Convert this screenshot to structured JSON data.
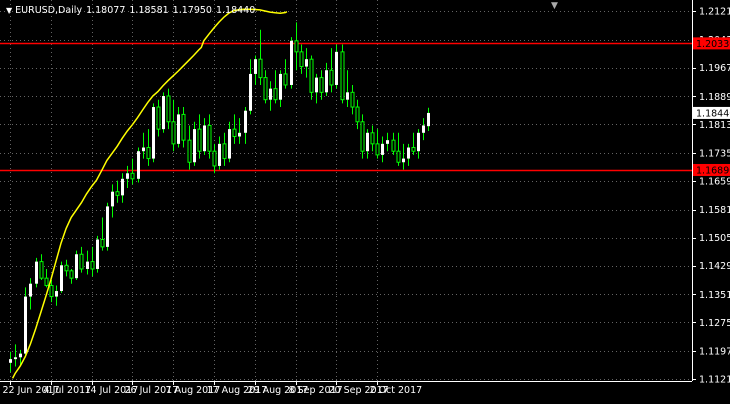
{
  "header": {
    "symbol_label": "EURUSD,Daily",
    "ohlc": [
      "1.18077",
      "1.18581",
      "1.17950",
      "1.18440"
    ]
  },
  "icons": {
    "menu": "triangle-down-icon",
    "corner": "triangle-down-icon"
  },
  "colors": {
    "background": "#000000",
    "bull": "#ffffff",
    "bear": "#000000",
    "wick": "#00ff00",
    "ma": "#ffff00",
    "hline": "#ff0000",
    "axis": "#ffffff",
    "grid": "#646464"
  },
  "chart_data": {
    "type": "candlestick",
    "title": "EURUSD,Daily",
    "grid": true,
    "ylim": [
      1.1121,
      1.2121
    ],
    "yticks": [
      "1.21210",
      "1.20430",
      "1.19670",
      "1.18890",
      "1.18130",
      "1.17350",
      "1.16590",
      "1.15810",
      "1.15050",
      "1.14290",
      "1.13510",
      "1.12750",
      "1.11970",
      "1.11210"
    ],
    "x_labels": [
      {
        "label": "22 Jun 2017",
        "index": 0
      },
      {
        "label": "4 Jul 2017",
        "index": 8
      },
      {
        "label": "14 Jul 2017",
        "index": 16
      },
      {
        "label": "26 Jul 2017",
        "index": 24
      },
      {
        "label": "7 Aug 2017",
        "index": 32
      },
      {
        "label": "17 Aug 2017",
        "index": 40
      },
      {
        "label": "29 Aug 2017",
        "index": 48
      },
      {
        "label": "8 Sep 2017",
        "index": 56
      },
      {
        "label": "20 Sep 2017",
        "index": 64
      },
      {
        "label": "2 Oct 2017",
        "index": 72
      }
    ],
    "candles": [
      [
        1.1165,
        1.1195,
        1.114,
        1.1175
      ],
      [
        1.1175,
        1.1215,
        1.1155,
        1.118
      ],
      [
        1.118,
        1.12,
        1.116,
        1.119
      ],
      [
        1.119,
        1.137,
        1.118,
        1.1345
      ],
      [
        1.1345,
        1.1395,
        1.131,
        1.138
      ],
      [
        1.138,
        1.145,
        1.137,
        1.144
      ],
      [
        1.144,
        1.146,
        1.139,
        1.1395
      ],
      [
        1.1395,
        1.142,
        1.137,
        1.1375
      ],
      [
        1.1375,
        1.139,
        1.133,
        1.1345
      ],
      [
        1.1345,
        1.1375,
        1.132,
        1.136
      ],
      [
        1.136,
        1.144,
        1.1355,
        1.143
      ],
      [
        1.143,
        1.1445,
        1.14,
        1.1415
      ],
      [
        1.1415,
        1.142,
        1.138,
        1.1395
      ],
      [
        1.1395,
        1.147,
        1.139,
        1.146
      ],
      [
        1.146,
        1.148,
        1.141,
        1.142
      ],
      [
        1.142,
        1.147,
        1.1405,
        1.144
      ],
      [
        1.144,
        1.148,
        1.14,
        1.142
      ],
      [
        1.142,
        1.151,
        1.141,
        1.15
      ],
      [
        1.15,
        1.156,
        1.147,
        1.148
      ],
      [
        1.148,
        1.16,
        1.147,
        1.159
      ],
      [
        1.159,
        1.165,
        1.156,
        1.163
      ],
      [
        1.163,
        1.166,
        1.16,
        1.162
      ],
      [
        1.162,
        1.168,
        1.16,
        1.1665
      ],
      [
        1.1665,
        1.17,
        1.164,
        1.168
      ],
      [
        1.168,
        1.172,
        1.165,
        1.1665
      ],
      [
        1.1665,
        1.175,
        1.1655,
        1.174
      ],
      [
        1.174,
        1.179,
        1.172,
        1.175
      ],
      [
        1.175,
        1.18,
        1.17,
        1.172
      ],
      [
        1.172,
        1.187,
        1.171,
        1.186
      ],
      [
        1.186,
        1.188,
        1.178,
        1.18
      ],
      [
        1.18,
        1.19,
        1.179,
        1.189
      ],
      [
        1.189,
        1.191,
        1.18,
        1.182
      ],
      [
        1.182,
        1.188,
        1.174,
        1.176
      ],
      [
        1.176,
        1.186,
        1.175,
        1.184
      ],
      [
        1.184,
        1.186,
        1.175,
        1.177
      ],
      [
        1.177,
        1.181,
        1.169,
        1.171
      ],
      [
        1.171,
        1.182,
        1.17,
        1.18
      ],
      [
        1.18,
        1.184,
        1.172,
        1.174
      ],
      [
        1.174,
        1.183,
        1.173,
        1.181
      ],
      [
        1.181,
        1.184,
        1.172,
        1.174
      ],
      [
        1.174,
        1.176,
        1.168,
        1.17
      ],
      [
        1.17,
        1.178,
        1.169,
        1.176
      ],
      [
        1.176,
        1.179,
        1.17,
        1.172
      ],
      [
        1.172,
        1.182,
        1.171,
        1.18
      ],
      [
        1.18,
        1.184,
        1.176,
        1.178
      ],
      [
        1.178,
        1.183,
        1.176,
        1.179
      ],
      [
        1.179,
        1.186,
        1.176,
        1.185
      ],
      [
        1.185,
        1.199,
        1.184,
        1.195
      ],
      [
        1.195,
        1.2,
        1.192,
        1.199
      ],
      [
        1.199,
        1.207,
        1.192,
        1.194
      ],
      [
        1.194,
        1.196,
        1.187,
        1.188
      ],
      [
        1.188,
        1.193,
        1.185,
        1.191
      ],
      [
        1.191,
        1.196,
        1.187,
        1.188
      ],
      [
        1.188,
        1.196,
        1.186,
        1.195
      ],
      [
        1.195,
        1.199,
        1.191,
        1.192
      ],
      [
        1.192,
        1.205,
        1.191,
        1.204
      ],
      [
        1.204,
        1.209,
        1.196,
        1.201
      ],
      [
        1.201,
        1.203,
        1.195,
        1.197
      ],
      [
        1.197,
        1.202,
        1.194,
        1.199
      ],
      [
        1.199,
        1.2,
        1.188,
        1.19
      ],
      [
        1.19,
        1.195,
        1.187,
        1.194
      ],
      [
        1.194,
        1.196,
        1.188,
        1.19
      ],
      [
        1.19,
        1.198,
        1.189,
        1.196
      ],
      [
        1.196,
        1.202,
        1.19,
        1.192
      ],
      [
        1.192,
        1.203,
        1.191,
        1.201
      ],
      [
        1.201,
        1.203,
        1.187,
        1.188
      ],
      [
        1.188,
        1.196,
        1.186,
        1.19
      ],
      [
        1.19,
        1.192,
        1.184,
        1.186
      ],
      [
        1.186,
        1.188,
        1.18,
        1.182
      ],
      [
        1.182,
        1.184,
        1.172,
        1.174
      ],
      [
        1.174,
        1.18,
        1.172,
        1.179
      ],
      [
        1.179,
        1.181,
        1.174,
        1.176
      ],
      [
        1.176,
        1.18,
        1.172,
        1.173
      ],
      [
        1.173,
        1.178,
        1.171,
        1.176
      ],
      [
        1.176,
        1.179,
        1.174,
        1.177
      ],
      [
        1.177,
        1.179,
        1.173,
        1.174
      ],
      [
        1.174,
        1.179,
        1.17,
        1.171
      ],
      [
        1.171,
        1.176,
        1.169,
        1.172
      ],
      [
        1.172,
        1.176,
        1.17,
        1.175
      ],
      [
        1.175,
        1.179,
        1.173,
        1.174
      ],
      [
        1.174,
        1.18,
        1.172,
        1.179
      ],
      [
        1.179,
        1.183,
        1.177,
        1.181
      ],
      [
        1.1808,
        1.1858,
        1.1795,
        1.1844
      ]
    ],
    "moving_average": [
      [
        5,
        1.1123
      ],
      [
        10,
        1.1136
      ],
      [
        20,
        1.1156
      ],
      [
        30,
        1.1182
      ],
      [
        40,
        1.1216
      ],
      [
        50,
        1.1256
      ],
      [
        60,
        1.13
      ],
      [
        70,
        1.1344
      ],
      [
        80,
        1.139
      ],
      [
        90,
        1.144
      ],
      [
        100,
        1.149
      ],
      [
        110,
        1.153
      ],
      [
        120,
        1.156
      ],
      [
        130,
        1.158
      ],
      [
        140,
        1.16
      ],
      [
        150,
        1.1624
      ],
      [
        160,
        1.1644
      ],
      [
        170,
        1.1662
      ],
      [
        180,
        1.1688
      ],
      [
        190,
        1.1715
      ],
      [
        200,
        1.1734
      ],
      [
        210,
        1.1753
      ],
      [
        220,
        1.1775
      ],
      [
        230,
        1.1795
      ],
      [
        240,
        1.1812
      ],
      [
        250,
        1.1831
      ],
      [
        260,
        1.1852
      ],
      [
        270,
        1.1872
      ],
      [
        280,
        1.189
      ],
      [
        290,
        1.1902
      ],
      [
        300,
        1.1918
      ],
      [
        310,
        1.1932
      ],
      [
        320,
        1.1945
      ],
      [
        330,
        1.1958
      ],
      [
        340,
        1.1972
      ],
      [
        350,
        1.1986
      ],
      [
        360,
        1.2
      ],
      [
        370,
        1.2015
      ],
      [
        375,
        1.2022
      ],
      [
        380,
        1.204
      ],
      [
        390,
        1.2058
      ],
      [
        400,
        1.2075
      ],
      [
        410,
        1.2091
      ],
      [
        420,
        1.2105
      ],
      [
        430,
        1.2116
      ],
      [
        440,
        1.2122
      ],
      [
        450,
        1.2125
      ],
      [
        460,
        1.2126
      ],
      [
        470,
        1.2126
      ],
      [
        480,
        1.2125
      ],
      [
        490,
        1.2124
      ],
      [
        500,
        1.2121
      ],
      [
        510,
        1.2118
      ],
      [
        520,
        1.2116
      ],
      [
        530,
        1.2115
      ],
      [
        540,
        1.2117
      ],
      [
        543,
        1.2119
      ]
    ],
    "horizontal_lines": [
      {
        "value": 1.2033,
        "label": "1.20330",
        "color": "#ff0000"
      },
      {
        "value": 1.1689,
        "label": "1.16890",
        "color": "#ff0000"
      }
    ],
    "price_marker": {
      "value": 1.1844,
      "label": "1.18440"
    }
  }
}
